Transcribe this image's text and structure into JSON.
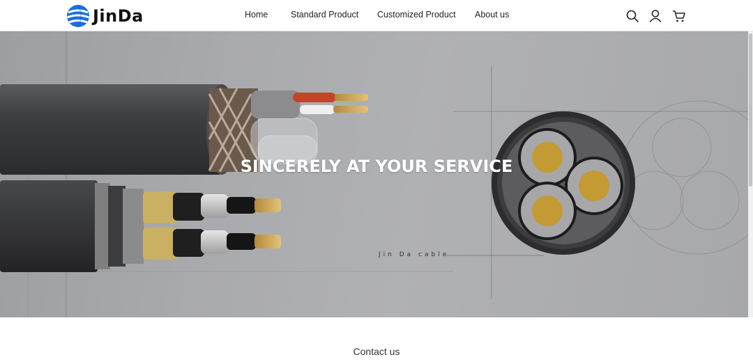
{
  "brand": {
    "name": "JinDa",
    "accent_color": "#1e6fd9"
  },
  "nav": {
    "items": [
      {
        "label": "Home"
      },
      {
        "label": "Standard Product"
      },
      {
        "label": "Customized Product"
      },
      {
        "label": "About us"
      }
    ]
  },
  "header_icons": [
    "search-icon",
    "user-icon",
    "cart-icon"
  ],
  "hero": {
    "title": "SINCERELY AT YOUR SERVICE",
    "caption": "Jin Da cable"
  },
  "footer": {
    "contact_label": "Contact us"
  }
}
